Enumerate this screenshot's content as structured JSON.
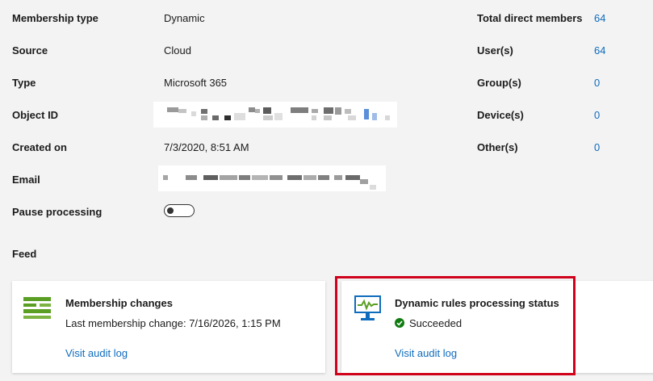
{
  "properties": [
    {
      "label": "Membership type",
      "value": "Dynamic"
    },
    {
      "label": "Source",
      "value": "Cloud"
    },
    {
      "label": "Type",
      "value": "Microsoft 365"
    },
    {
      "label": "Object ID",
      "value": ""
    },
    {
      "label": "Created on",
      "value": "7/3/2020, 8:51 AM"
    },
    {
      "label": "Email",
      "value": ""
    },
    {
      "label": "Pause processing",
      "value": ""
    }
  ],
  "counts": [
    {
      "label": "Total direct members",
      "value": "64"
    },
    {
      "label": "User(s)",
      "value": "64"
    },
    {
      "label": "Group(s)",
      "value": "0"
    },
    {
      "label": "Device(s)",
      "value": "0"
    },
    {
      "label": "Other(s)",
      "value": "0"
    }
  ],
  "pause_processing": {
    "state": "off"
  },
  "feed": {
    "title": "Feed",
    "cards": [
      {
        "title": "Membership changes",
        "subtitle": "Last membership change: 7/16/2026, 1:15 PM",
        "link": "Visit audit log",
        "icon": "membership-list-icon"
      },
      {
        "title": "Dynamic rules processing status",
        "status": "Succeeded",
        "status_icon": "checkmark-circle-icon",
        "link": "Visit audit log",
        "icon": "monitor-pulse-icon"
      }
    ]
  },
  "colors": {
    "link": "#0f6cbd",
    "success": "#107c10",
    "highlight": "#d0021b",
    "icon_green": "#5a9e24",
    "icon_blue": "#0f6cbd"
  }
}
